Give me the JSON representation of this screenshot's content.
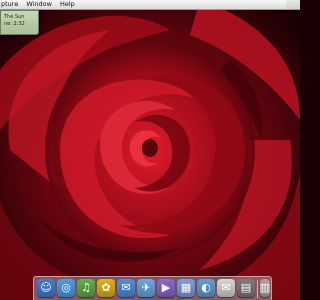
{
  "menubar": {
    "items": [
      {
        "label": "pture"
      },
      {
        "label": "Window"
      },
      {
        "label": "Help"
      }
    ]
  },
  "mini_panel": {
    "line1": "The Sun",
    "line2": "ne: 2:32"
  },
  "dock": {
    "items": [
      {
        "name": "finder-icon",
        "glyph": "☺",
        "color": "#3f7fd6"
      },
      {
        "name": "safari-icon",
        "glyph": "◎",
        "color": "#4aa0e6"
      },
      {
        "name": "itunes-icon",
        "glyph": "♫",
        "color": "#5fb04a"
      },
      {
        "name": "iphoto-icon",
        "glyph": "✿",
        "color": "#e2b21a"
      },
      {
        "name": "ichat-icon",
        "glyph": "✉",
        "color": "#4f8fe0"
      },
      {
        "name": "mail-icon",
        "glyph": "✈",
        "color": "#6aa8e8"
      },
      {
        "name": "imovie-icon",
        "glyph": "▶",
        "color": "#8a6ad0"
      },
      {
        "name": "ical-icon",
        "glyph": "▦",
        "color": "#7aa0e0"
      },
      {
        "name": "preview-icon",
        "glyph": "◐",
        "color": "#5fa0d8"
      },
      {
        "name": "address-book-icon",
        "glyph": "✉",
        "color": "#d8d8d8"
      },
      {
        "name": "calculator-icon",
        "glyph": "▤",
        "color": "#7c7c7c"
      },
      {
        "name": "trash-icon",
        "glyph": "▥",
        "color": "#a8a8a8"
      }
    ]
  },
  "wallpaper": {
    "subject": "red rose",
    "colors": {
      "dark": "#1a0003",
      "mid": "#8a0010",
      "bright": "#d41524",
      "shadow": "#3a0008"
    }
  }
}
